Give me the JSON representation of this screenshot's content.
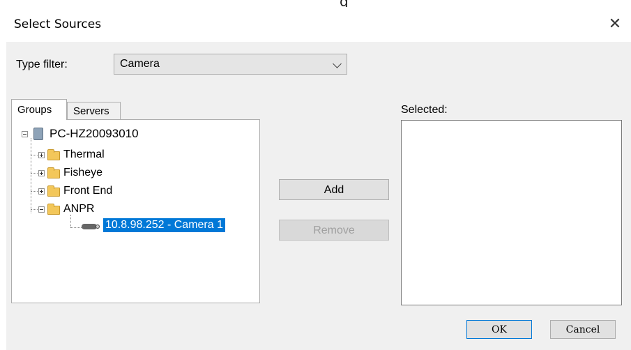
{
  "top_strip_text": "g",
  "dialog": {
    "title": "Select Sources",
    "close_glyph": "✕"
  },
  "filter": {
    "label": "Type filter:",
    "selected": "Camera"
  },
  "tabs": [
    {
      "label": "Groups",
      "active": true
    },
    {
      "label": "Servers",
      "active": false
    }
  ],
  "tree": {
    "root": "PC-HZ20093010",
    "groups": [
      "Thermal",
      "Fisheye",
      "Front End",
      "ANPR"
    ],
    "expanded_group": "ANPR",
    "camera": "10.8.98.252 - Camera 1"
  },
  "selected_label": "Selected:",
  "buttons": {
    "add": "Add",
    "remove": "Remove",
    "ok": "OK",
    "cancel": "Cancel"
  },
  "colors": {
    "selection": "#0078d7",
    "dialog_bg": "#f0f0f0",
    "folder": "#f3c75a"
  }
}
